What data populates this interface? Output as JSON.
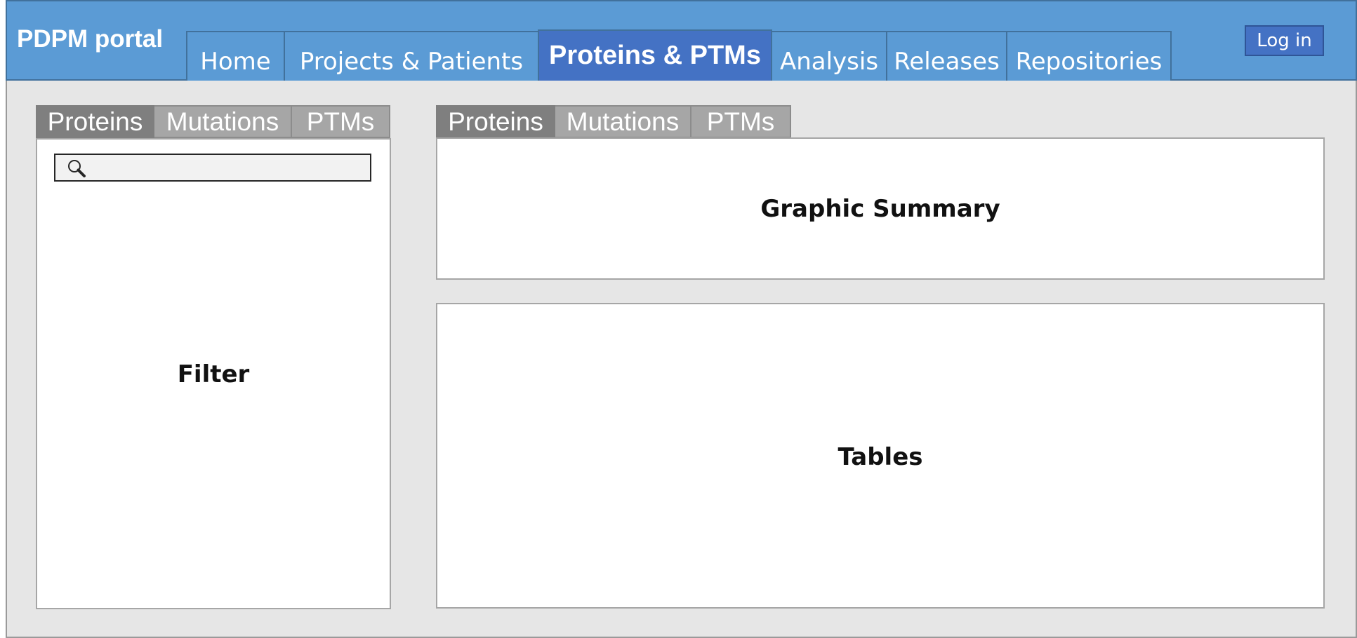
{
  "header": {
    "brand": "PDPM portal",
    "nav": [
      {
        "label": "Home",
        "active": false
      },
      {
        "label": "Projects & Patients",
        "active": false
      },
      {
        "label": "Proteins & PTMs",
        "active": true
      },
      {
        "label": "Analysis",
        "active": false
      },
      {
        "label": "Releases",
        "active": false
      },
      {
        "label": "Repositories",
        "active": false
      }
    ],
    "login_label": "Log in"
  },
  "filter_panel": {
    "tabs": [
      {
        "label": "Proteins",
        "active": true
      },
      {
        "label": "Mutations",
        "active": false
      },
      {
        "label": "PTMs",
        "active": false
      }
    ],
    "search_icon": "search-icon",
    "label": "Filter"
  },
  "results_panel": {
    "tabs": [
      {
        "label": "Proteins",
        "active": true
      },
      {
        "label": "Mutations",
        "active": false
      },
      {
        "label": "PTMs",
        "active": false
      }
    ],
    "summary_label": "Graphic Summary",
    "tables_label": "Tables"
  },
  "colors": {
    "header_bg": "#5b9bd5",
    "active_nav_bg": "#4472c4",
    "active_subtab_bg": "#7f7f7f",
    "subtab_bg": "#a6a6a6",
    "canvas_bg": "#e6e6e6"
  }
}
